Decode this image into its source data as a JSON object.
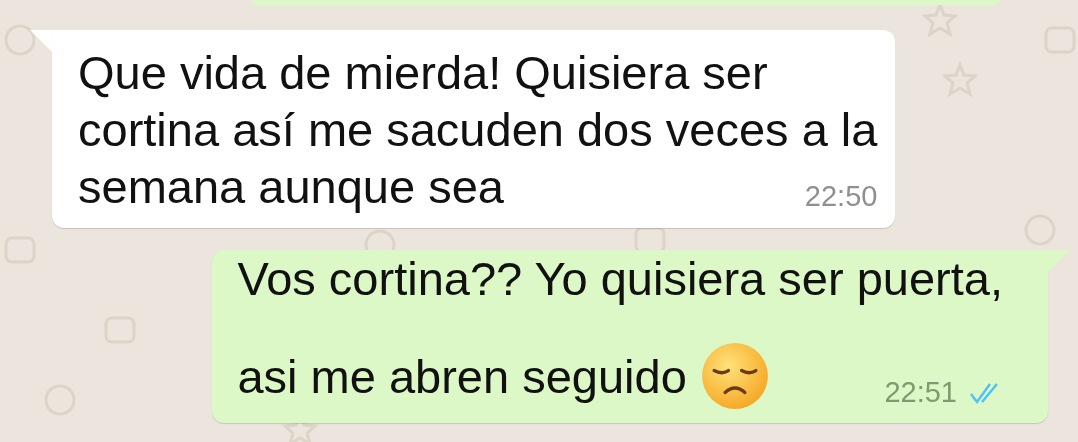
{
  "messages": [
    {
      "kind": "incoming",
      "lines": [
        "Que vida de mierda! Quisiera ser",
        "cortina así me sacuden dos veces a la",
        "semana aunque sea"
      ],
      "time": "22:50"
    },
    {
      "kind": "outgoing",
      "lines": [
        "Vos cortina?? Yo quisiera ser puerta,",
        "asi me abren seguido"
      ],
      "emoji": {
        "kind": "sad_face"
      },
      "time": "22:51",
      "read": true
    }
  ]
}
